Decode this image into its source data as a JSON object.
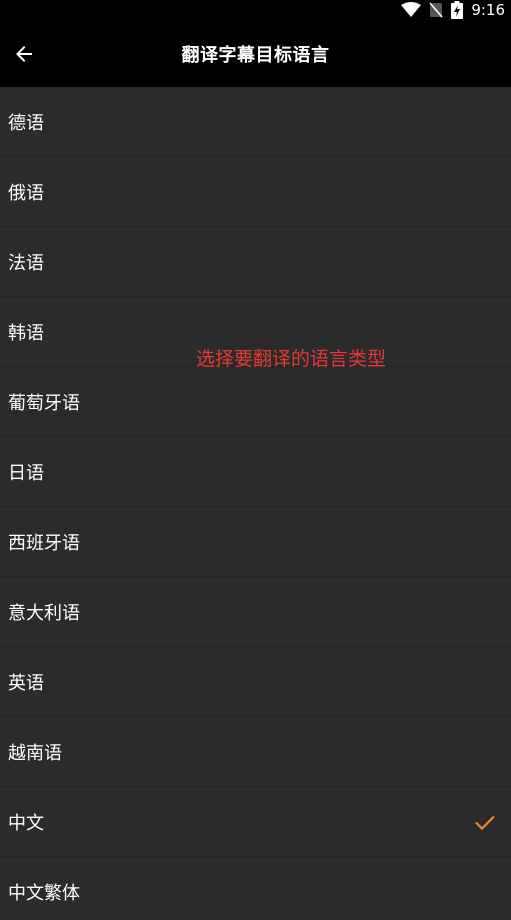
{
  "status_bar": {
    "time": "9:16",
    "icons": [
      "wifi-icon",
      "no-sim-icon",
      "battery-charging-icon"
    ]
  },
  "app_bar": {
    "back_icon": "arrow-left-icon",
    "title": "翻译字幕目标语言"
  },
  "languages": [
    {
      "label": "德语",
      "selected": false
    },
    {
      "label": "俄语",
      "selected": false
    },
    {
      "label": "法语",
      "selected": false
    },
    {
      "label": "韩语",
      "selected": false
    },
    {
      "label": "葡萄牙语",
      "selected": false
    },
    {
      "label": "日语",
      "selected": false
    },
    {
      "label": "西班牙语",
      "selected": false
    },
    {
      "label": "意大利语",
      "selected": false
    },
    {
      "label": "英语",
      "selected": false
    },
    {
      "label": "越南语",
      "selected": false
    },
    {
      "label": "中文",
      "selected": true
    },
    {
      "label": "中文繁体",
      "selected": false
    }
  ],
  "hint": "选择要翻译的语言类型",
  "colors": {
    "background": "#2b2b2b",
    "app_bar": "#000000",
    "check": "#f08a24",
    "hint": "#e53935"
  }
}
